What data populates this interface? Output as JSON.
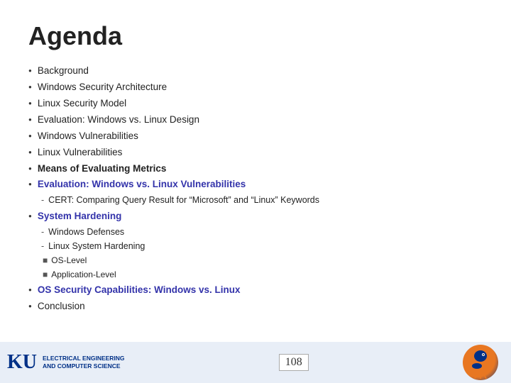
{
  "slide": {
    "title": "Agenda",
    "bullets": [
      {
        "id": "bg",
        "text": "Background",
        "style": "normal"
      },
      {
        "id": "wsa",
        "text": "Windows Security Architecture",
        "style": "normal"
      },
      {
        "id": "lsm",
        "text": "Linux Security Model",
        "style": "normal"
      },
      {
        "id": "eval",
        "text": "Evaluation: Windows vs. Linux Design",
        "style": "normal"
      },
      {
        "id": "wv",
        "text": "Windows Vulnerabilities",
        "style": "normal"
      },
      {
        "id": "lv",
        "text": "Linux Vulnerabilities",
        "style": "normal"
      },
      {
        "id": "mem",
        "text": "Means of Evaluating Metrics",
        "style": "bold"
      },
      {
        "id": "ewlv",
        "text": "Evaluation: Windows vs. Linux Vulnerabilities",
        "style": "bold-blue"
      }
    ],
    "sub_ewlv": [
      {
        "text": "CERT: Comparing Query Result for “Microsoft” and “Linux” Keywords"
      }
    ],
    "system_hardening": {
      "label": "System Hardening",
      "style": "bold-blue",
      "sub": [
        {
          "text": "Windows Defenses"
        },
        {
          "text": "Linux System Hardening",
          "subsub": [
            {
              "text": "OS-Level"
            },
            {
              "text": "Application-Level"
            }
          ]
        }
      ]
    },
    "os_security": {
      "text": "OS Security Capabilities: Windows vs. Linux",
      "style": "bold-blue"
    },
    "conclusion": {
      "text": "Conclusion",
      "style": "normal"
    }
  },
  "footer": {
    "ku_name_line1": "ELECTRICAL ENGINEERING",
    "ku_name_line2": "AND COMPUTER SCIENCE",
    "ku_letters": "KU",
    "page_number": "108"
  }
}
